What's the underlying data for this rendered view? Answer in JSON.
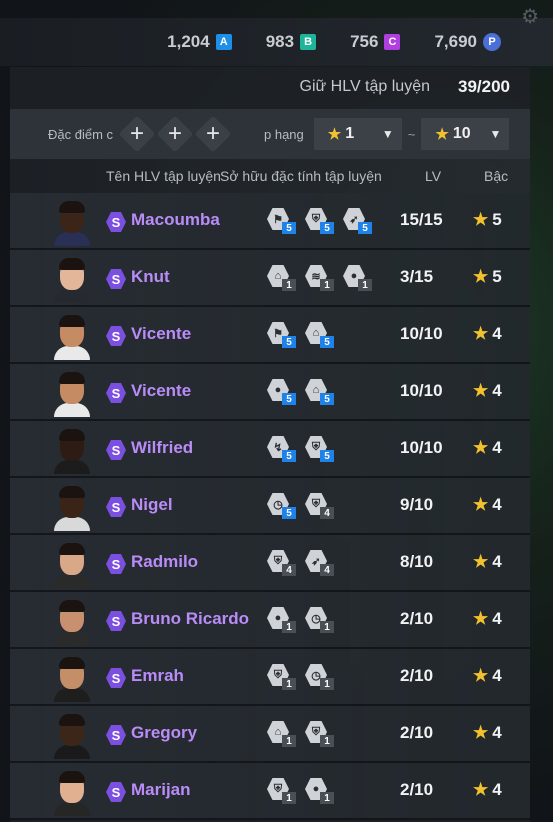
{
  "currencies": [
    {
      "value": "1,204",
      "badge": "A",
      "color": "#1e8fe8",
      "icon": "a-token-icon"
    },
    {
      "value": "983",
      "badge": "B",
      "color": "#1fb59a",
      "icon": "b-token-icon"
    },
    {
      "value": "756",
      "badge": "C",
      "color": "#b13fe0",
      "icon": "c-token-icon"
    },
    {
      "value": "7,690",
      "badge": "P",
      "color": "#4a6fd8",
      "icon": "p-coin-icon"
    }
  ],
  "hold": {
    "label": "Giữ HLV tập luyện",
    "count": "39/200"
  },
  "filter": {
    "trait_label": "Đặc điểm c",
    "rank_label": "p hạng",
    "from": "1",
    "to": "10",
    "tilde": "~"
  },
  "columns": {
    "name": "Tên HLV tập luyện",
    "traits": "Sở hữu đặc tính tập luyện",
    "lv": "LV",
    "rank": "Bậc"
  },
  "coaches": [
    {
      "name": "Macoumba",
      "lv": "15/15",
      "rank": "5",
      "skin": "#3b2418",
      "shirt": "#2a2f55",
      "traits": [
        {
          "icon": "whistle-icon",
          "level": "5",
          "hi": true
        },
        {
          "icon": "shield-icon",
          "level": "5",
          "hi": true
        },
        {
          "icon": "running-icon",
          "level": "5",
          "hi": true
        }
      ]
    },
    {
      "name": "Knut",
      "lv": "3/15",
      "rank": "5",
      "skin": "#e3b69a",
      "shirt": "#262a30",
      "traits": [
        {
          "icon": "lock-icon",
          "level": "1",
          "hi": false
        },
        {
          "icon": "wind-icon",
          "level": "1",
          "hi": false
        },
        {
          "icon": "ball-icon",
          "level": "1",
          "hi": false
        }
      ]
    },
    {
      "name": "Vicente",
      "lv": "10/10",
      "rank": "4",
      "skin": "#c58c64",
      "shirt": "#e9e9e9",
      "traits": [
        {
          "icon": "whistle-icon",
          "level": "5",
          "hi": true
        },
        {
          "icon": "lock-icon",
          "level": "5",
          "hi": true
        }
      ]
    },
    {
      "name": "Vicente",
      "lv": "10/10",
      "rank": "4",
      "skin": "#c58c64",
      "shirt": "#e9e9e9",
      "traits": [
        {
          "icon": "ball-icon",
          "level": "5",
          "hi": true
        },
        {
          "icon": "lock-icon",
          "level": "5",
          "hi": true
        }
      ]
    },
    {
      "name": "Wilfried",
      "lv": "10/10",
      "rank": "4",
      "skin": "#2e1c14",
      "shirt": "#1c1c1c",
      "traits": [
        {
          "icon": "tackle-icon",
          "level": "5",
          "hi": true
        },
        {
          "icon": "shield-icon",
          "level": "5",
          "hi": true
        }
      ]
    },
    {
      "name": "Nigel",
      "lv": "9/10",
      "rank": "4",
      "skin": "#3a2418",
      "shirt": "#d9d9d9",
      "traits": [
        {
          "icon": "timer-icon",
          "level": "5",
          "hi": true
        },
        {
          "icon": "shield-icon",
          "level": "4",
          "hi": false
        }
      ]
    },
    {
      "name": "Radmilo",
      "lv": "8/10",
      "rank": "4",
      "skin": "#d8a888",
      "shirt": "#2a2a2a",
      "traits": [
        {
          "icon": "shield-icon",
          "level": "4",
          "hi": false
        },
        {
          "icon": "running-icon",
          "level": "4",
          "hi": false
        }
      ]
    },
    {
      "name": "Bruno Ricardo",
      "lv": "2/10",
      "rank": "4",
      "skin": "#c99070",
      "shirt": "#2b2b2b",
      "traits": [
        {
          "icon": "ball-icon",
          "level": "1",
          "hi": false
        },
        {
          "icon": "timer-icon",
          "level": "1",
          "hi": false
        }
      ]
    },
    {
      "name": "Emrah",
      "lv": "2/10",
      "rank": "4",
      "skin": "#c48e68",
      "shirt": "#1e1e1e",
      "traits": [
        {
          "icon": "shield-icon",
          "level": "1",
          "hi": false
        },
        {
          "icon": "timer-icon",
          "level": "1",
          "hi": false
        }
      ]
    },
    {
      "name": "Gregory",
      "lv": "2/10",
      "rank": "4",
      "skin": "#3c2619",
      "shirt": "#1a1a1a",
      "traits": [
        {
          "icon": "lock-icon",
          "level": "1",
          "hi": false
        },
        {
          "icon": "shield-icon",
          "level": "1",
          "hi": false
        }
      ]
    },
    {
      "name": "Marijan",
      "lv": "2/10",
      "rank": "4",
      "skin": "#e0b090",
      "shirt": "#262626",
      "traits": [
        {
          "icon": "shield-icon",
          "level": "1",
          "hi": false
        },
        {
          "icon": "ball-icon",
          "level": "1",
          "hi": false
        }
      ]
    }
  ]
}
